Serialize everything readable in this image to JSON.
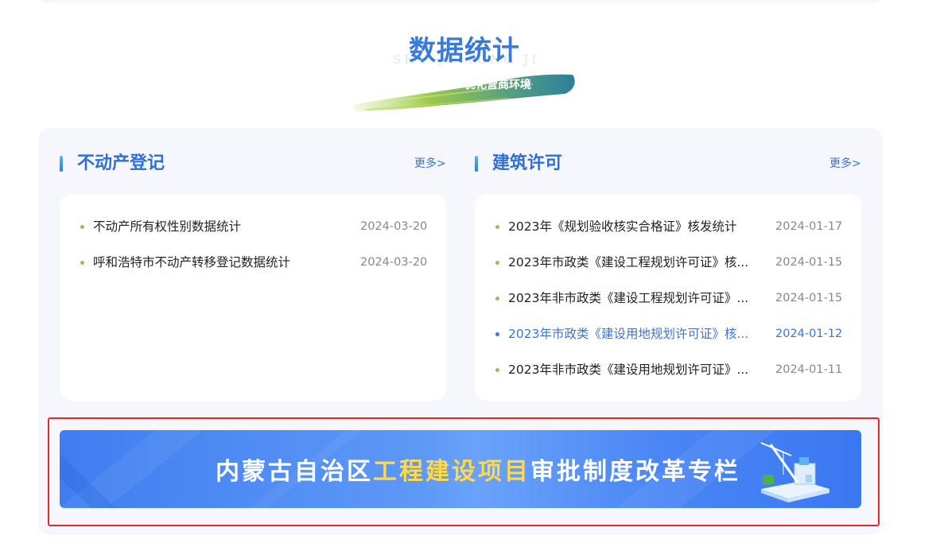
{
  "section": {
    "title": "数据统计",
    "pinyin": "SHU JU TONG JI",
    "subtitle": "优化营商环境"
  },
  "columns": [
    {
      "title": "不动产登记",
      "more": "更多>",
      "items": [
        {
          "title": "不动产所有权性别数据统计",
          "date": "2024-03-20"
        },
        {
          "title": "呼和浩特市不动产转移登记数据统计",
          "date": "2024-03-20"
        }
      ]
    },
    {
      "title": "建筑许可",
      "more": "更多>",
      "items": [
        {
          "title": "2023年《规划验收核实合格证》核发统计",
          "date": "2024-01-17"
        },
        {
          "title": "2023年市政类《建设工程规划许可证》核...",
          "date": "2024-01-15"
        },
        {
          "title": "2023年非市政类《建设工程规划许可证》...",
          "date": "2024-01-15"
        },
        {
          "title": "2023年市政类《建设用地规划许可证》核...",
          "date": "2024-01-12"
        },
        {
          "title": "2023年非市政类《建设用地规划许可证》...",
          "date": "2024-01-11"
        }
      ]
    }
  ],
  "banner": {
    "text_before": "内蒙古自治区",
    "text_highlight": "工程建设项目",
    "text_after": "审批制度改革专栏",
    "icon": "construction-crane-icon"
  },
  "colors": {
    "accent": "#2f6fd8",
    "bullet": "#8fc25a",
    "banner_highlight": "#ffd94a",
    "selection_border": "#e8262b"
  }
}
